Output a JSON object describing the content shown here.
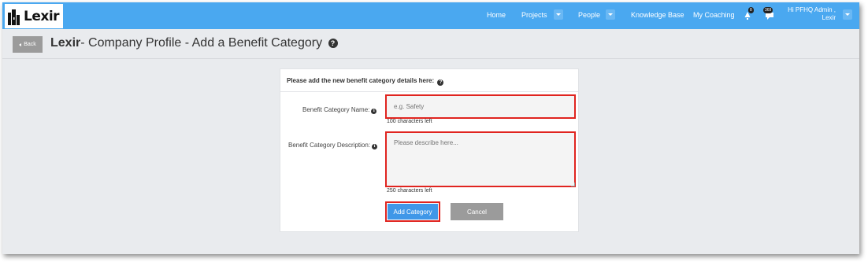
{
  "app": {
    "logo_text": "Lexir"
  },
  "nav": {
    "home": "Home",
    "projects": "Projects",
    "people": "People",
    "knowledge_base": "Knowledge Base",
    "my_coaching": "My Coaching",
    "alerts_count": "8",
    "messages_count": "369",
    "user_greeting": "Hi PFHQ Admin ,",
    "user_company": "Lexir"
  },
  "header": {
    "back_label": "Back",
    "title_brand": "Lexir",
    "title_rest": "- Company Profile - Add a Benefit Category"
  },
  "form": {
    "intro": "Please add the new benefit category details here:",
    "name_label": "Benefit Category Name:",
    "name_placeholder": "e.g. Safety",
    "name_counter": "100 characters left",
    "desc_label": "Benefit Category Description:",
    "desc_placeholder": "Please describe here...",
    "desc_counter": "250 characters left",
    "add_button": "Add Category",
    "cancel_button": "Cancel"
  },
  "colors": {
    "nav_bg": "#4aa8f0",
    "primary": "#3f97e8",
    "highlight": "#e0241f",
    "secondary": "#9b9b9b"
  },
  "icons": [
    "logo-building-icon",
    "caret-down-icon",
    "bell-icon",
    "chat-icon",
    "help-icon",
    "info-icon"
  ]
}
